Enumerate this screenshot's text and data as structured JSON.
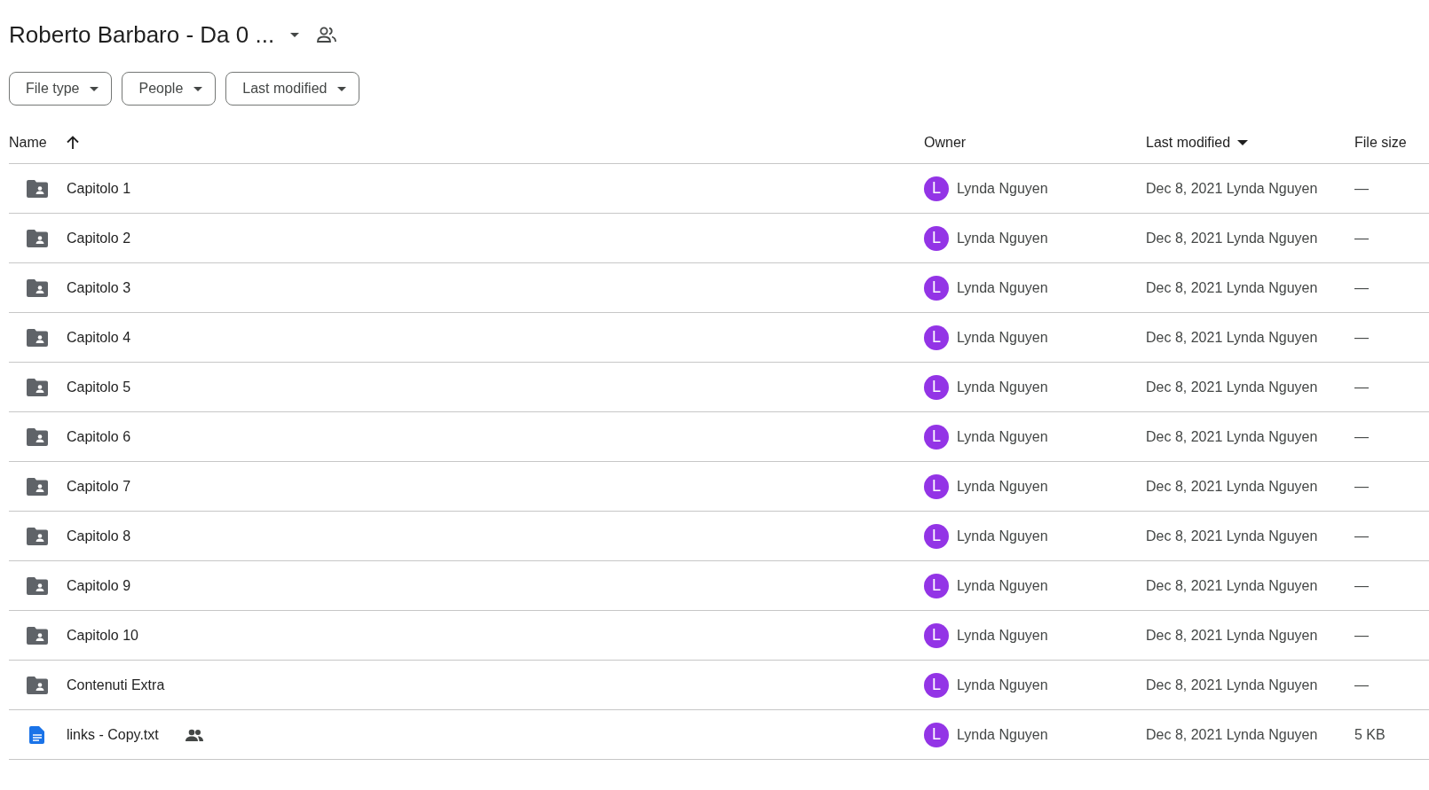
{
  "header": {
    "title": "Roberto Barbaro - Da 0 ...",
    "shared": true
  },
  "filters": [
    "File type",
    "People",
    "Last modified"
  ],
  "table": {
    "columns": [
      {
        "label": "Name",
        "sorted_ascending": true,
        "sorted_descending": false
      },
      {
        "label": "Owner",
        "sorted_ascending": false,
        "sorted_descending": false
      },
      {
        "label": "Last modified",
        "sorted_ascending": false,
        "sorted_descending": true
      },
      {
        "label": "File size",
        "sorted_ascending": false,
        "sorted_descending": false
      }
    ],
    "rows": [
      {
        "kind": "folder",
        "name": "Capitolo 1",
        "shared": false,
        "owner_initial": "L",
        "color": "#9334e6",
        "owner": "Lynda Nguyen",
        "modified": "Dec 8, 2021 Lynda Nguyen",
        "size": "—"
      },
      {
        "kind": "folder",
        "name": "Capitolo 2",
        "shared": false,
        "owner_initial": "L",
        "color": "#9334e6",
        "owner": "Lynda Nguyen",
        "modified": "Dec 8, 2021 Lynda Nguyen",
        "size": "—"
      },
      {
        "kind": "folder",
        "name": "Capitolo 3",
        "shared": false,
        "owner_initial": "L",
        "color": "#9334e6",
        "owner": "Lynda Nguyen",
        "modified": "Dec 8, 2021 Lynda Nguyen",
        "size": "—"
      },
      {
        "kind": "folder",
        "name": "Capitolo 4",
        "shared": false,
        "owner_initial": "L",
        "color": "#9334e6",
        "owner": "Lynda Nguyen",
        "modified": "Dec 8, 2021 Lynda Nguyen",
        "size": "—"
      },
      {
        "kind": "folder",
        "name": "Capitolo 5",
        "shared": false,
        "owner_initial": "L",
        "color": "#9334e6",
        "owner": "Lynda Nguyen",
        "modified": "Dec 8, 2021 Lynda Nguyen",
        "size": "—"
      },
      {
        "kind": "folder",
        "name": "Capitolo 6",
        "shared": false,
        "owner_initial": "L",
        "color": "#9334e6",
        "owner": "Lynda Nguyen",
        "modified": "Dec 8, 2021 Lynda Nguyen",
        "size": "—"
      },
      {
        "kind": "folder",
        "name": "Capitolo 7",
        "shared": false,
        "owner_initial": "L",
        "color": "#9334e6",
        "owner": "Lynda Nguyen",
        "modified": "Dec 8, 2021 Lynda Nguyen",
        "size": "—"
      },
      {
        "kind": "folder",
        "name": "Capitolo 8",
        "shared": false,
        "owner_initial": "L",
        "color": "#9334e6",
        "owner": "Lynda Nguyen",
        "modified": "Dec 8, 2021 Lynda Nguyen",
        "size": "—"
      },
      {
        "kind": "folder",
        "name": "Capitolo 9",
        "shared": false,
        "owner_initial": "L",
        "color": "#9334e6",
        "owner": "Lynda Nguyen",
        "modified": "Dec 8, 2021 Lynda Nguyen",
        "size": "—"
      },
      {
        "kind": "folder",
        "name": "Capitolo 10",
        "shared": false,
        "owner_initial": "L",
        "color": "#9334e6",
        "owner": "Lynda Nguyen",
        "modified": "Dec 8, 2021 Lynda Nguyen",
        "size": "—"
      },
      {
        "kind": "folder",
        "name": "Contenuti Extra",
        "shared": false,
        "owner_initial": "L",
        "color": "#9334e6",
        "owner": "Lynda Nguyen",
        "modified": "Dec 8, 2021 Lynda Nguyen",
        "size": "—"
      },
      {
        "kind": "file",
        "name": "links - Copy.txt",
        "shared": true,
        "owner_initial": "L",
        "color": "#9334e6",
        "owner": "Lynda Nguyen",
        "modified": "Dec 8, 2021 Lynda Nguyen",
        "size": "5 KB"
      }
    ]
  }
}
